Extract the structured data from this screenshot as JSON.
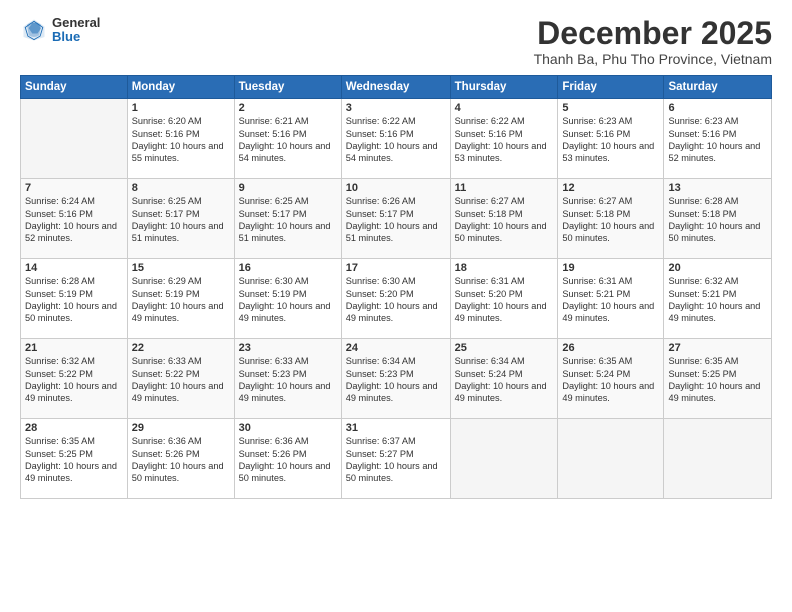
{
  "logo": {
    "general": "General",
    "blue": "Blue"
  },
  "title": "December 2025",
  "location": "Thanh Ba, Phu Tho Province, Vietnam",
  "days_of_week": [
    "Sunday",
    "Monday",
    "Tuesday",
    "Wednesday",
    "Thursday",
    "Friday",
    "Saturday"
  ],
  "weeks": [
    [
      {
        "day": "",
        "sunrise": "",
        "sunset": "",
        "daylight": "",
        "empty": true
      },
      {
        "day": "1",
        "sunrise": "Sunrise: 6:20 AM",
        "sunset": "Sunset: 5:16 PM",
        "daylight": "Daylight: 10 hours and 55 minutes."
      },
      {
        "day": "2",
        "sunrise": "Sunrise: 6:21 AM",
        "sunset": "Sunset: 5:16 PM",
        "daylight": "Daylight: 10 hours and 54 minutes."
      },
      {
        "day": "3",
        "sunrise": "Sunrise: 6:22 AM",
        "sunset": "Sunset: 5:16 PM",
        "daylight": "Daylight: 10 hours and 54 minutes."
      },
      {
        "day": "4",
        "sunrise": "Sunrise: 6:22 AM",
        "sunset": "Sunset: 5:16 PM",
        "daylight": "Daylight: 10 hours and 53 minutes."
      },
      {
        "day": "5",
        "sunrise": "Sunrise: 6:23 AM",
        "sunset": "Sunset: 5:16 PM",
        "daylight": "Daylight: 10 hours and 53 minutes."
      },
      {
        "day": "6",
        "sunrise": "Sunrise: 6:23 AM",
        "sunset": "Sunset: 5:16 PM",
        "daylight": "Daylight: 10 hours and 52 minutes."
      }
    ],
    [
      {
        "day": "7",
        "sunrise": "Sunrise: 6:24 AM",
        "sunset": "Sunset: 5:16 PM",
        "daylight": "Daylight: 10 hours and 52 minutes."
      },
      {
        "day": "8",
        "sunrise": "Sunrise: 6:25 AM",
        "sunset": "Sunset: 5:17 PM",
        "daylight": "Daylight: 10 hours and 51 minutes."
      },
      {
        "day": "9",
        "sunrise": "Sunrise: 6:25 AM",
        "sunset": "Sunset: 5:17 PM",
        "daylight": "Daylight: 10 hours and 51 minutes."
      },
      {
        "day": "10",
        "sunrise": "Sunrise: 6:26 AM",
        "sunset": "Sunset: 5:17 PM",
        "daylight": "Daylight: 10 hours and 51 minutes."
      },
      {
        "day": "11",
        "sunrise": "Sunrise: 6:27 AM",
        "sunset": "Sunset: 5:18 PM",
        "daylight": "Daylight: 10 hours and 50 minutes."
      },
      {
        "day": "12",
        "sunrise": "Sunrise: 6:27 AM",
        "sunset": "Sunset: 5:18 PM",
        "daylight": "Daylight: 10 hours and 50 minutes."
      },
      {
        "day": "13",
        "sunrise": "Sunrise: 6:28 AM",
        "sunset": "Sunset: 5:18 PM",
        "daylight": "Daylight: 10 hours and 50 minutes."
      }
    ],
    [
      {
        "day": "14",
        "sunrise": "Sunrise: 6:28 AM",
        "sunset": "Sunset: 5:19 PM",
        "daylight": "Daylight: 10 hours and 50 minutes."
      },
      {
        "day": "15",
        "sunrise": "Sunrise: 6:29 AM",
        "sunset": "Sunset: 5:19 PM",
        "daylight": "Daylight: 10 hours and 49 minutes."
      },
      {
        "day": "16",
        "sunrise": "Sunrise: 6:30 AM",
        "sunset": "Sunset: 5:19 PM",
        "daylight": "Daylight: 10 hours and 49 minutes."
      },
      {
        "day": "17",
        "sunrise": "Sunrise: 6:30 AM",
        "sunset": "Sunset: 5:20 PM",
        "daylight": "Daylight: 10 hours and 49 minutes."
      },
      {
        "day": "18",
        "sunrise": "Sunrise: 6:31 AM",
        "sunset": "Sunset: 5:20 PM",
        "daylight": "Daylight: 10 hours and 49 minutes."
      },
      {
        "day": "19",
        "sunrise": "Sunrise: 6:31 AM",
        "sunset": "Sunset: 5:21 PM",
        "daylight": "Daylight: 10 hours and 49 minutes."
      },
      {
        "day": "20",
        "sunrise": "Sunrise: 6:32 AM",
        "sunset": "Sunset: 5:21 PM",
        "daylight": "Daylight: 10 hours and 49 minutes."
      }
    ],
    [
      {
        "day": "21",
        "sunrise": "Sunrise: 6:32 AM",
        "sunset": "Sunset: 5:22 PM",
        "daylight": "Daylight: 10 hours and 49 minutes."
      },
      {
        "day": "22",
        "sunrise": "Sunrise: 6:33 AM",
        "sunset": "Sunset: 5:22 PM",
        "daylight": "Daylight: 10 hours and 49 minutes."
      },
      {
        "day": "23",
        "sunrise": "Sunrise: 6:33 AM",
        "sunset": "Sunset: 5:23 PM",
        "daylight": "Daylight: 10 hours and 49 minutes."
      },
      {
        "day": "24",
        "sunrise": "Sunrise: 6:34 AM",
        "sunset": "Sunset: 5:23 PM",
        "daylight": "Daylight: 10 hours and 49 minutes."
      },
      {
        "day": "25",
        "sunrise": "Sunrise: 6:34 AM",
        "sunset": "Sunset: 5:24 PM",
        "daylight": "Daylight: 10 hours and 49 minutes."
      },
      {
        "day": "26",
        "sunrise": "Sunrise: 6:35 AM",
        "sunset": "Sunset: 5:24 PM",
        "daylight": "Daylight: 10 hours and 49 minutes."
      },
      {
        "day": "27",
        "sunrise": "Sunrise: 6:35 AM",
        "sunset": "Sunset: 5:25 PM",
        "daylight": "Daylight: 10 hours and 49 minutes."
      }
    ],
    [
      {
        "day": "28",
        "sunrise": "Sunrise: 6:35 AM",
        "sunset": "Sunset: 5:25 PM",
        "daylight": "Daylight: 10 hours and 49 minutes."
      },
      {
        "day": "29",
        "sunrise": "Sunrise: 6:36 AM",
        "sunset": "Sunset: 5:26 PM",
        "daylight": "Daylight: 10 hours and 50 minutes."
      },
      {
        "day": "30",
        "sunrise": "Sunrise: 6:36 AM",
        "sunset": "Sunset: 5:26 PM",
        "daylight": "Daylight: 10 hours and 50 minutes."
      },
      {
        "day": "31",
        "sunrise": "Sunrise: 6:37 AM",
        "sunset": "Sunset: 5:27 PM",
        "daylight": "Daylight: 10 hours and 50 minutes."
      },
      {
        "day": "",
        "sunrise": "",
        "sunset": "",
        "daylight": "",
        "empty": true
      },
      {
        "day": "",
        "sunrise": "",
        "sunset": "",
        "daylight": "",
        "empty": true
      },
      {
        "day": "",
        "sunrise": "",
        "sunset": "",
        "daylight": "",
        "empty": true
      }
    ]
  ]
}
